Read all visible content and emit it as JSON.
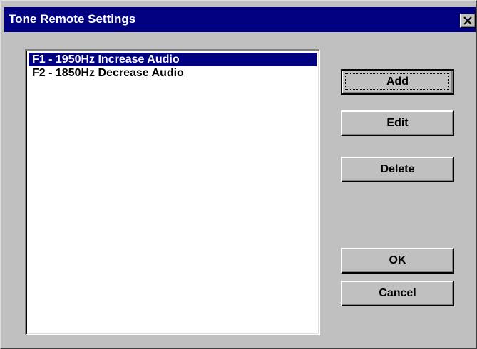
{
  "window": {
    "title": "Tone Remote Settings",
    "close_icon": "close-icon"
  },
  "tone_list": {
    "items": [
      {
        "label": "F1 - 1950Hz Increase Audio",
        "selected": true
      },
      {
        "label": "F2 - 1850Hz Decrease Audio",
        "selected": false
      }
    ]
  },
  "buttons": {
    "add": "Add",
    "edit": "Edit",
    "delete": "Delete",
    "ok": "OK",
    "cancel": "Cancel"
  },
  "colors": {
    "titlebar": "#000080",
    "face": "#c0c0c0",
    "selection": "#000080"
  }
}
